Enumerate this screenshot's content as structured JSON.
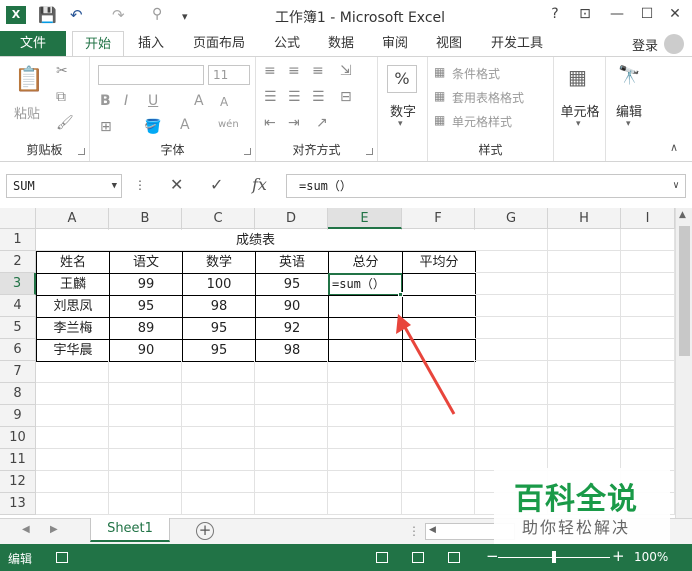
{
  "window": {
    "title": "工作簿1 - Microsoft Excel",
    "help": "?",
    "restore_ribbon": "⊡",
    "minimize": "—",
    "maximize": "☐",
    "close": "✕"
  },
  "qat": {
    "save": "💾",
    "undo": "↶",
    "redo": "↷",
    "customize": "▾"
  },
  "tabs": {
    "file": "文件",
    "items": [
      "开始",
      "插入",
      "页面布局",
      "公式",
      "数据",
      "审阅",
      "视图",
      "开发工具"
    ],
    "active": "开始",
    "login": "登录"
  },
  "ribbon": {
    "clipboard": {
      "paste": "粘贴",
      "label": "剪贴板"
    },
    "font": {
      "label": "字体",
      "size": "11",
      "bold": "B",
      "italic": "I",
      "underline": "U",
      "grow": "A",
      "shrink": "A",
      "color": "A",
      "phonetic": "wén"
    },
    "alignment": {
      "label": "对齐方式"
    },
    "number": {
      "percent": "%",
      "label_btn": "数字"
    },
    "styles": {
      "conditional": "条件格式",
      "table": "套用表格格式",
      "cell": "单元格样式",
      "label": "样式"
    },
    "cells": {
      "label": "单元格"
    },
    "editing": {
      "label": "编辑"
    }
  },
  "formula_bar": {
    "name_box": "SUM",
    "cancel": "✕",
    "enter": "✓",
    "fx": "fx",
    "content": "=sum（）"
  },
  "grid": {
    "columns": [
      "A",
      "B",
      "C",
      "D",
      "E",
      "F",
      "G",
      "H",
      "I"
    ],
    "rows": [
      "1",
      "2",
      "3",
      "4",
      "5",
      "6",
      "7",
      "8",
      "9",
      "10",
      "11",
      "12",
      "13"
    ],
    "selected_column": "E",
    "selected_row": "3",
    "title": "成绩表",
    "headers": [
      "姓名",
      "语文",
      "数学",
      "英语",
      "总分",
      "平均分"
    ],
    "records": [
      [
        "王麟",
        "99",
        "100",
        "95",
        "=sum（）",
        ""
      ],
      [
        "刘思凤",
        "95",
        "98",
        "90",
        "",
        ""
      ],
      [
        "李兰梅",
        "89",
        "95",
        "92",
        "",
        ""
      ],
      [
        "宇华晨",
        "90",
        "95",
        "98",
        "",
        ""
      ]
    ]
  },
  "sheets": {
    "tabs": [
      "Sheet1"
    ],
    "add": "+"
  },
  "status": {
    "mode": "编辑",
    "zoom": "100%",
    "zoom_minus": "−",
    "zoom_plus": "+"
  },
  "watermark": {
    "main": "百科全说",
    "sub": "助你轻松解决"
  },
  "colors": {
    "accent": "#217346",
    "arrow": "#e8453c",
    "watermark": "#1a9a48"
  }
}
